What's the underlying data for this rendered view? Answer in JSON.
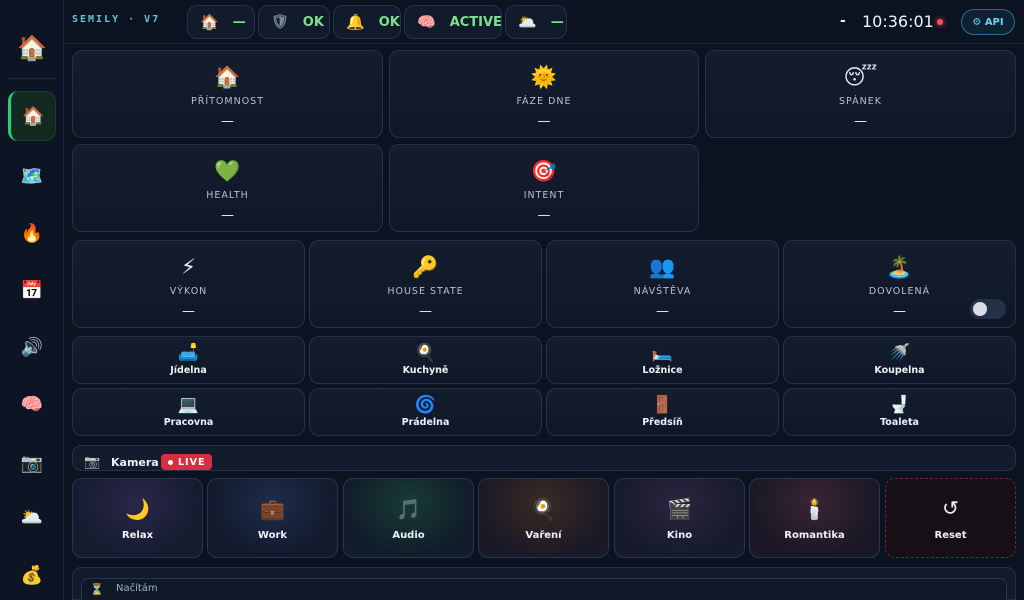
{
  "sidebar": {
    "logo_icon": "🏠",
    "items": [
      {
        "name": "home",
        "icon": "🏠"
      },
      {
        "name": "map",
        "icon": "🗺️"
      },
      {
        "name": "energy",
        "icon": "🔥"
      },
      {
        "name": "calendar",
        "icon": "📅"
      },
      {
        "name": "audio",
        "icon": "🔊"
      },
      {
        "name": "brain",
        "icon": "🧠"
      },
      {
        "name": "camera",
        "icon": "📷"
      },
      {
        "name": "weather",
        "icon": "🌥️"
      },
      {
        "name": "finance",
        "icon": "💰"
      }
    ]
  },
  "topbar": {
    "brand": "SEMILY · V7",
    "chips": [
      {
        "icon": "🏠",
        "value": "—"
      },
      {
        "icon": "🛡",
        "value": "OK"
      },
      {
        "icon": "🔔",
        "value": "OK"
      },
      {
        "icon": "🧠",
        "value": "ACTIVE"
      },
      {
        "icon": "🌥️",
        "value": "—"
      }
    ],
    "clock_prefix": "-",
    "clock": "10:36:01",
    "api_label": "⚙ API"
  },
  "stats_row1": [
    {
      "icon": "🏠",
      "label": "PŘÍTOMNOST",
      "value": "—"
    },
    {
      "icon": "🌞",
      "label": "FÁZE DNE",
      "value": "—"
    },
    {
      "icon": "😴",
      "label": "SPÁNEK",
      "value": "—"
    }
  ],
  "stats_row2": [
    {
      "icon": "💚",
      "label": "HEALTH",
      "value": "—"
    },
    {
      "icon": "🎯",
      "label": "INTENT",
      "value": "—"
    }
  ],
  "stats_row3": [
    {
      "icon": "⚡",
      "label": "VÝKON",
      "value": "—"
    },
    {
      "icon": "🔑",
      "label": "HOUSE STATE",
      "value": "—"
    },
    {
      "icon": "👥",
      "label": "NÁVŠTĚVA",
      "value": "—"
    },
    {
      "icon": "🏝️",
      "label": "DOVOLENÁ",
      "value": "—"
    }
  ],
  "rooms": [
    {
      "icon": "🛋️",
      "label": "Jídelna"
    },
    {
      "icon": "🍳",
      "label": "Kuchyně"
    },
    {
      "icon": "🛏️",
      "label": "Ložnice"
    },
    {
      "icon": "🚿",
      "label": "Koupelna"
    },
    {
      "icon": "💻",
      "label": "Pracovna"
    },
    {
      "icon": "🌀",
      "label": "Prádelna"
    },
    {
      "icon": "🚪",
      "label": "Předsíň"
    },
    {
      "icon": "🚽",
      "label": "Toaleta"
    }
  ],
  "camera": {
    "icon": "📷",
    "title": "Kamera",
    "live_label": "LIVE"
  },
  "scenes": [
    {
      "icon": "🌙",
      "label": "Relax"
    },
    {
      "icon": "💼",
      "label": "Work"
    },
    {
      "icon": "🎵",
      "label": "Audio"
    },
    {
      "icon": "🍳",
      "label": "Vaření"
    },
    {
      "icon": "🎬",
      "label": "Kino"
    },
    {
      "icon": "🕯️",
      "label": "Romantika"
    },
    {
      "icon": "↺",
      "label": "Reset"
    }
  ],
  "status": {
    "icon": "⏳",
    "text": "Načítám"
  },
  "colors": {
    "accent_green": "#2ecc71",
    "live_red": "#d92e3f",
    "api_cyan": "#6fd0ef"
  }
}
